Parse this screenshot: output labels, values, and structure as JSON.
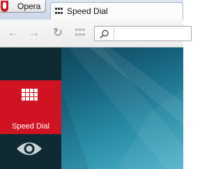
{
  "app": {
    "menu_label": "Opera"
  },
  "tab": {
    "title": "Speed Dial",
    "icon": "speed-dial-icon"
  },
  "toolbar": {
    "back_icon": "back-arrow-icon",
    "forward_icon": "forward-arrow-icon",
    "reload_icon": "reload-icon",
    "speed_dial_icon": "speed-dial-icon",
    "search_icon": "search-icon",
    "address_value": ""
  },
  "sidebar": {
    "items": [
      {
        "label": "Speed Dial",
        "icon": "speed-dial-icon",
        "active": true
      },
      {
        "label": "",
        "icon": "eye-icon",
        "active": false
      }
    ]
  },
  "colors": {
    "accent": "#d01322",
    "sidebar": "#0f2a33",
    "background": "#2b8fa8"
  }
}
